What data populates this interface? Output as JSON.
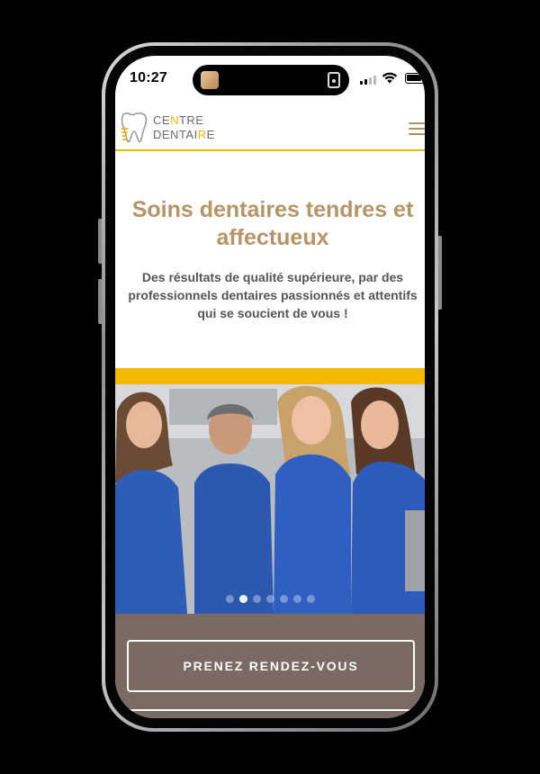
{
  "status_bar": {
    "time": "10:27"
  },
  "site": {
    "logo_line1_part1": "CE",
    "logo_line1_hl": "N",
    "logo_line1_part2": "TRE",
    "logo_line2_part1": "DENTAI",
    "logo_line2_hl": "R",
    "logo_line2_part2": "E"
  },
  "hero": {
    "title": "Soins dentaires tendres et affectueux",
    "subtitle": "Des résultats de qualité supérieure, par des professionnels dentaires passionnés et attentifs qui se soucient de vous !"
  },
  "carousel": {
    "slide_count": 7,
    "active_index": 1
  },
  "cta": {
    "label": "PRENEZ RENDEZ-VOUS"
  },
  "colors": {
    "accent_gold": "#b79465",
    "accent_yellow": "#f5b800",
    "cta_background": "#7b6a61"
  }
}
